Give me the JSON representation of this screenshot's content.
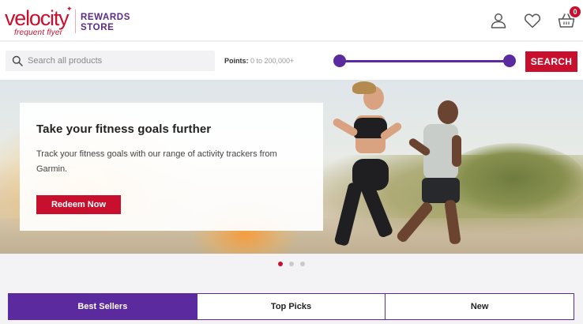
{
  "brand": {
    "logo_word": "velocity",
    "logo_sub": "frequent flyer",
    "rewards": "REWARDS",
    "store": "STORE",
    "primary_color": "#c8102e",
    "secondary_color": "#5b2a9e"
  },
  "header": {
    "icons": [
      "user-icon",
      "heart-icon",
      "basket-icon"
    ],
    "cart_count": "0"
  },
  "search": {
    "placeholder": "Search all products",
    "value": "",
    "points_label": "Points:",
    "points_range": "0 to 200,000+",
    "button_label": "SEARCH"
  },
  "hero": {
    "title": "Take your fitness goals further",
    "text": "Track your fitness goals with our range of activity trackers from Garmin.",
    "button_label": "Redeem Now",
    "active_slide": 1,
    "slide_count": 3
  },
  "tabs": [
    {
      "label": "Best Sellers",
      "active": true
    },
    {
      "label": "Top Picks",
      "active": false
    },
    {
      "label": "New",
      "active": false
    }
  ]
}
